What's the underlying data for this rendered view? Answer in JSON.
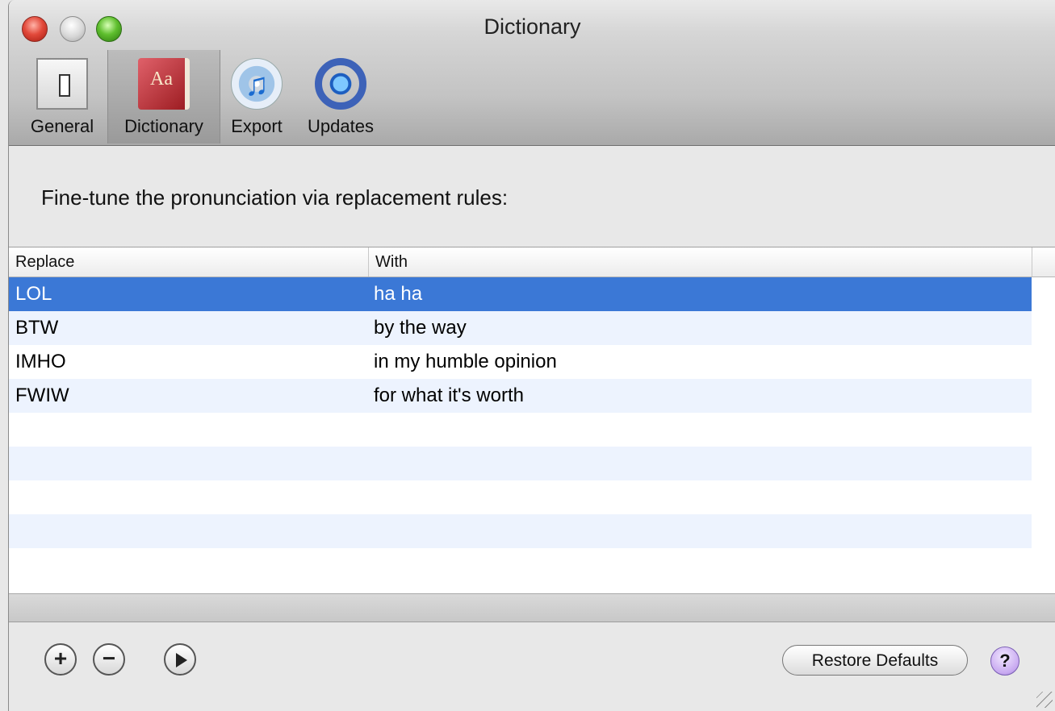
{
  "window": {
    "title": "Dictionary"
  },
  "toolbar": {
    "items": [
      {
        "label": "General",
        "icon": "switch-icon"
      },
      {
        "label": "Dictionary",
        "icon": "dictionary-book-icon",
        "icon_text": "Aa"
      },
      {
        "label": "Export",
        "icon": "itunes-cd-icon"
      },
      {
        "label": "Updates",
        "icon": "sync-globe-icon"
      }
    ],
    "selected": "Dictionary"
  },
  "main": {
    "description": "Fine-tune the pronunciation via replacement rules:",
    "table": {
      "columns": [
        "Replace",
        "With"
      ],
      "rows": [
        {
          "replace": "LOL",
          "with": "ha ha",
          "selected": true
        },
        {
          "replace": "BTW",
          "with": "by the way"
        },
        {
          "replace": "IMHO",
          "with": "in my humble opinion"
        },
        {
          "replace": "FWIW",
          "with": "for what it's worth"
        }
      ]
    }
  },
  "footer": {
    "add_symbol": "+",
    "remove_symbol": "−",
    "restore_label": "Restore Defaults",
    "help_symbol": "?"
  },
  "colors": {
    "selection": "#3b78d6",
    "alt_row": "#edf3fe"
  }
}
